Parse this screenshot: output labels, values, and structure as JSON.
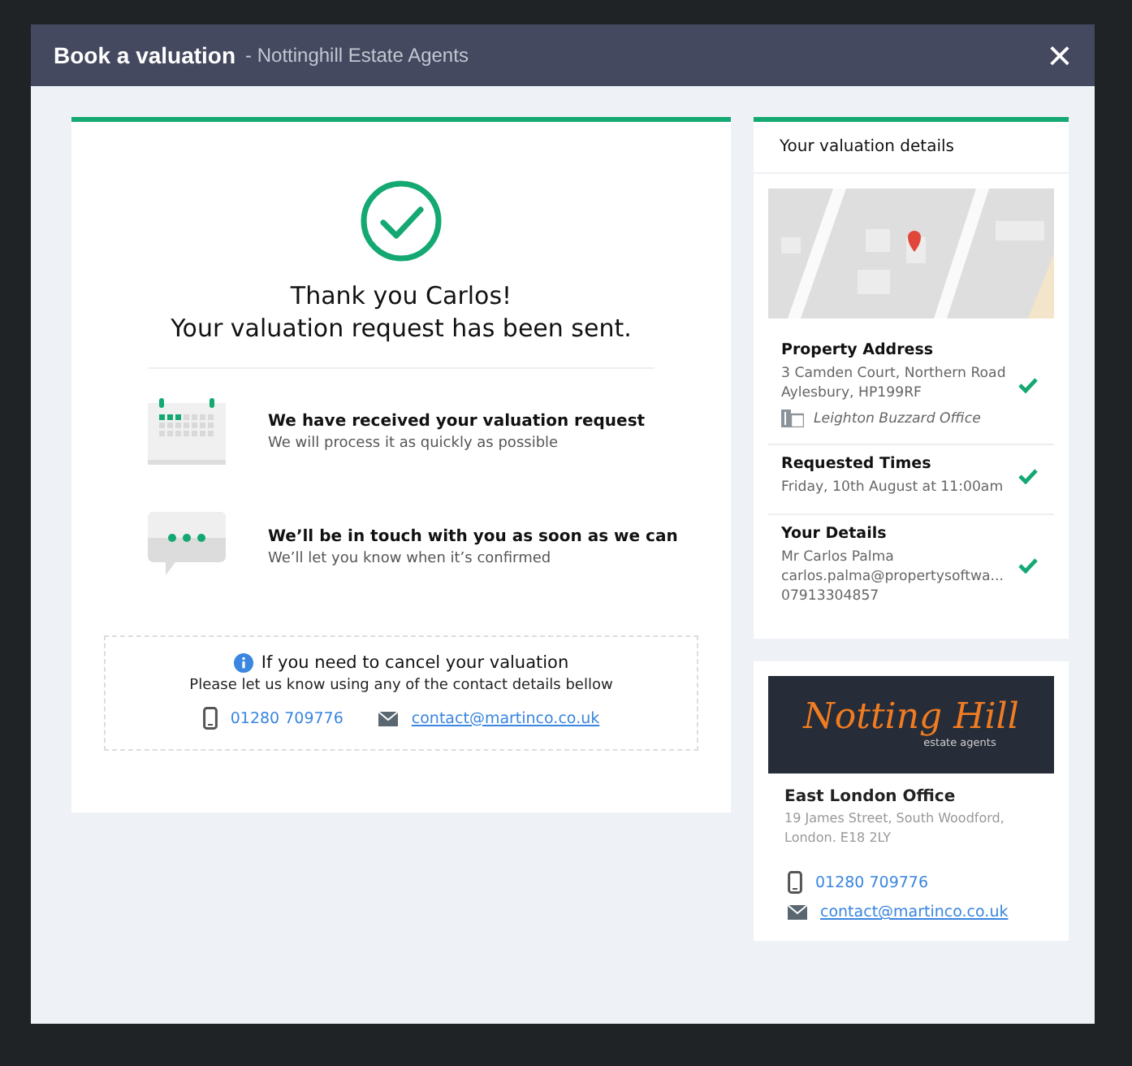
{
  "modal": {
    "title": "Book a valuation",
    "subtitle": "- Nottinghill Estate Agents",
    "close": "×"
  },
  "confirmation": {
    "heading_line1": "Thank you Carlos!",
    "heading_line2": "Your valuation request has been sent.",
    "steps": [
      {
        "kind": "calendar",
        "title": "We have received your valuation request",
        "text": "We will process it as quickly as possible"
      },
      {
        "kind": "chat",
        "title": "We’ll be in touch with you as soon as we can",
        "text": "We’ll let you know when it’s confirmed"
      }
    ],
    "cancel": {
      "title": "If you need to cancel your valuation",
      "text": "Please let us know using any of the contact details bellow",
      "phone": "01280 709776",
      "email": "contact@martinco.co.uk"
    }
  },
  "details": {
    "title": "Your valuation details",
    "sections": [
      {
        "label": "Property Address",
        "lines": [
          "3 Camden Court, Northern Road",
          "Aylesbury, HP199RF"
        ],
        "office": "Leighton Buzzard Office",
        "verified": true
      },
      {
        "label": "Requested Times",
        "lines": [
          "Friday, 10th August at 11:00am"
        ],
        "verified": true
      },
      {
        "label": "Your Details",
        "lines": [
          "Mr Carlos Palma",
          "carlos.palma@propertysoftwa...",
          "07913304857"
        ],
        "verified": true
      }
    ]
  },
  "office": {
    "logo_title": "Notting Hill",
    "logo_subtitle": "estate agents",
    "name": "East London Office",
    "address_lines": [
      "19 James Street, South Woodford,",
      "London. E18 2LY"
    ],
    "phone": "01280 709776",
    "email": "contact@martinco.co.uk"
  }
}
